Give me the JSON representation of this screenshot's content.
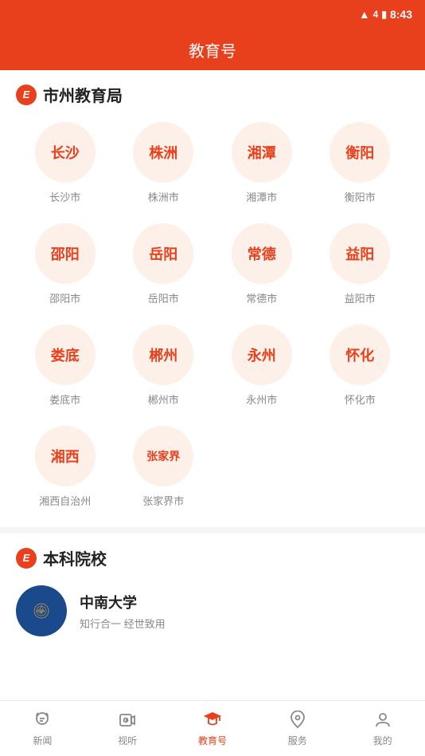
{
  "statusBar": {
    "time": "8:43"
  },
  "header": {
    "title": "教育号"
  },
  "sections": [
    {
      "id": "municipal",
      "iconLabel": "E",
      "title": "市州教育局",
      "cities": [
        {
          "name": "长沙",
          "label": "长沙市"
        },
        {
          "name": "株洲",
          "label": "株洲市"
        },
        {
          "name": "湘潭",
          "label": "湘潭市"
        },
        {
          "name": "衡阳",
          "label": "衡阳市"
        },
        {
          "name": "邵阳",
          "label": "邵阳市"
        },
        {
          "name": "岳阳",
          "label": "岳阳市"
        },
        {
          "name": "常德",
          "label": "常德市"
        },
        {
          "name": "益阳",
          "label": "益阳市"
        },
        {
          "name": "娄底",
          "label": "娄底市"
        },
        {
          "name": "郴州",
          "label": "郴州市"
        },
        {
          "name": "永州",
          "label": "永州市"
        },
        {
          "name": "怀化",
          "label": "怀化市"
        },
        {
          "name": "湘西",
          "label": "湘西自治州"
        },
        {
          "name": "张家界",
          "label": "张家界市"
        }
      ]
    },
    {
      "id": "universities",
      "iconLabel": "E",
      "title": "本科院校",
      "universities": [
        {
          "name": "中南大学",
          "motto": "知行合一 经世致用"
        }
      ]
    }
  ],
  "bottomNav": [
    {
      "id": "news",
      "label": "新闻",
      "active": false,
      "icon": "news-icon"
    },
    {
      "id": "video",
      "label": "视听",
      "active": false,
      "icon": "video-icon"
    },
    {
      "id": "education",
      "label": "教育号",
      "active": true,
      "icon": "education-icon"
    },
    {
      "id": "service",
      "label": "服务",
      "active": false,
      "icon": "service-icon"
    },
    {
      "id": "mine",
      "label": "我的",
      "active": false,
      "icon": "mine-icon"
    }
  ]
}
